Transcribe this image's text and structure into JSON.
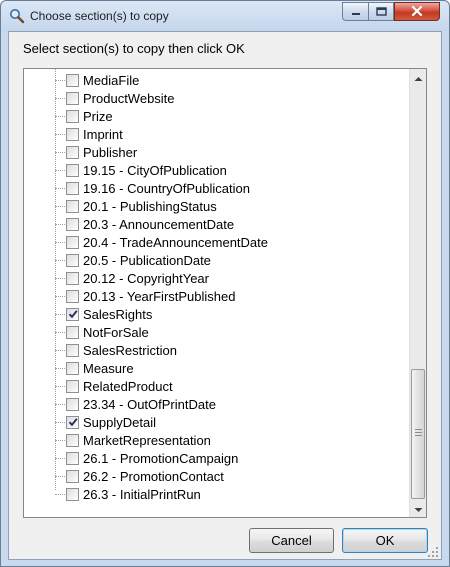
{
  "window": {
    "title": "Choose section(s) to copy"
  },
  "dialog": {
    "instruction": "Select section(s) to copy then click OK",
    "cancel_label": "Cancel",
    "ok_label": "OK"
  },
  "tree": {
    "items": [
      {
        "label": "MediaFile",
        "checked": false
      },
      {
        "label": "ProductWebsite",
        "checked": false
      },
      {
        "label": "Prize",
        "checked": false
      },
      {
        "label": "Imprint",
        "checked": false
      },
      {
        "label": "Publisher",
        "checked": false
      },
      {
        "label": "19.15 - CityOfPublication",
        "checked": false
      },
      {
        "label": "19.16 - CountryOfPublication",
        "checked": false
      },
      {
        "label": "20.1 - PublishingStatus",
        "checked": false
      },
      {
        "label": "20.3 - AnnouncementDate",
        "checked": false
      },
      {
        "label": "20.4 - TradeAnnouncementDate",
        "checked": false
      },
      {
        "label": "20.5 - PublicationDate",
        "checked": false
      },
      {
        "label": "20.12 - CopyrightYear",
        "checked": false
      },
      {
        "label": "20.13 - YearFirstPublished",
        "checked": false
      },
      {
        "label": "SalesRights",
        "checked": true
      },
      {
        "label": "NotForSale",
        "checked": false
      },
      {
        "label": "SalesRestriction",
        "checked": false
      },
      {
        "label": "Measure",
        "checked": false
      },
      {
        "label": "RelatedProduct",
        "checked": false
      },
      {
        "label": "23.34 - OutOfPrintDate",
        "checked": false
      },
      {
        "label": "SupplyDetail",
        "checked": true
      },
      {
        "label": "MarketRepresentation",
        "checked": false
      },
      {
        "label": "26.1 - PromotionCampaign",
        "checked": false
      },
      {
        "label": "26.2 - PromotionContact",
        "checked": false
      },
      {
        "label": "26.3 - InitialPrintRun",
        "checked": false
      }
    ]
  },
  "icons": {
    "title": "magnifier-icon",
    "minimize": "minimize-icon",
    "maximize": "maximize-icon",
    "close": "close-icon",
    "scroll_up": "chevron-up-icon",
    "scroll_down": "chevron-down-icon",
    "check": "checkmark-icon"
  },
  "colors": {
    "close_button": "#c8442e",
    "title_bar": "#c5d6ec",
    "ok_border": "#3c7fb1"
  }
}
